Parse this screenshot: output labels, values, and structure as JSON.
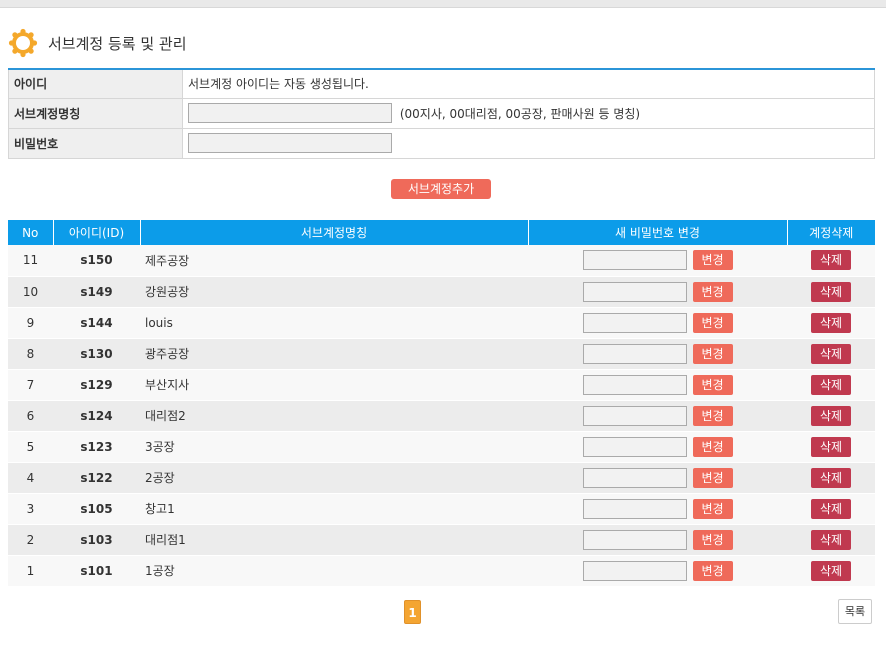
{
  "page": {
    "title": "서브계정 등록 및 관리",
    "title_icon": "sun-gear-icon",
    "accent_color": "#f4a82b"
  },
  "form": {
    "rows": [
      {
        "label": "아이디",
        "value": "서브계정 아이디는 자동 생성됩니다."
      },
      {
        "label": "서브계정명칭",
        "input_value": "",
        "hint": "(00지사, 00대리점, 00공장, 판매사원 등 명칭)"
      },
      {
        "label": "비밀번호",
        "input_value": ""
      }
    ],
    "add_button": "서브계정추가"
  },
  "table": {
    "headers": [
      "No",
      "아이디(ID)",
      "서브계정명칭",
      "새 비밀번호 변경",
      "계정삭제"
    ],
    "header_color": "#0c9ce9",
    "change_label": "변경",
    "delete_label": "삭제",
    "rows": [
      {
        "no": "11",
        "id": "s150",
        "name": "제주공장"
      },
      {
        "no": "10",
        "id": "s149",
        "name": "강원공장"
      },
      {
        "no": "9",
        "id": "s144",
        "name": "louis"
      },
      {
        "no": "8",
        "id": "s130",
        "name": "광주공장"
      },
      {
        "no": "7",
        "id": "s129",
        "name": "부산지사"
      },
      {
        "no": "6",
        "id": "s124",
        "name": "대리점2"
      },
      {
        "no": "5",
        "id": "s123",
        "name": "3공장"
      },
      {
        "no": "4",
        "id": "s122",
        "name": "2공장"
      },
      {
        "no": "3",
        "id": "s105",
        "name": "창고1"
      },
      {
        "no": "2",
        "id": "s103",
        "name": "대리점1"
      },
      {
        "no": "1",
        "id": "s101",
        "name": "1공장"
      }
    ]
  },
  "pagination": {
    "current_page": "1",
    "list_button": "목록"
  },
  "colors": {
    "change_button": "#ef6a5a",
    "delete_button": "#c0394f",
    "current_page": "#f4a532"
  }
}
